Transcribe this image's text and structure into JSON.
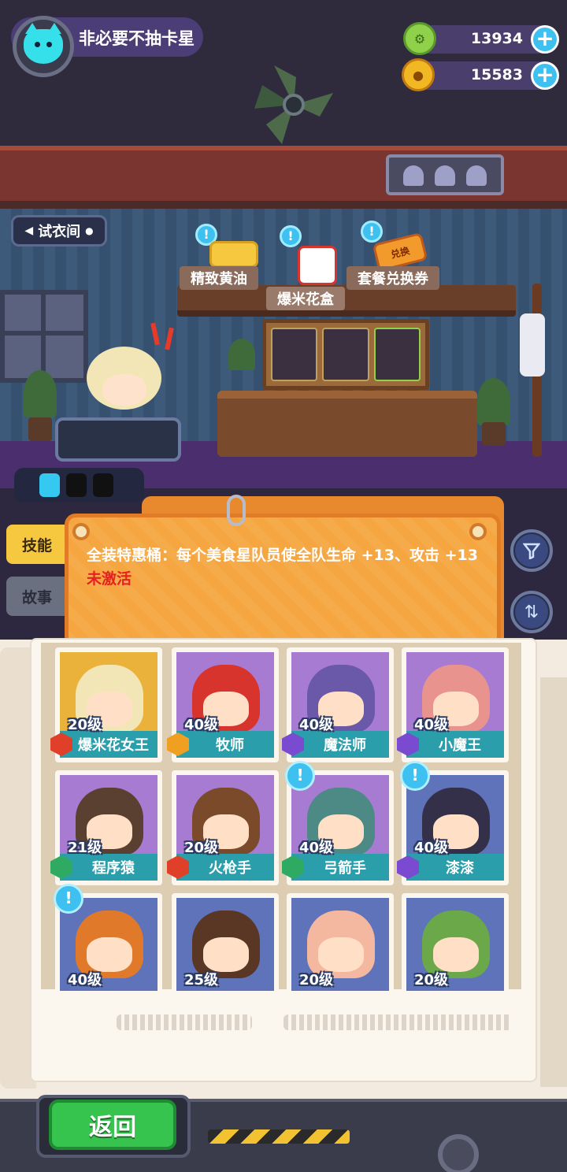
{
  "player": {
    "name": "非必要不抽卡星"
  },
  "currencies": [
    {
      "icon": "green-gear-coin-icon",
      "value": "13934",
      "color": "#8fd14a"
    },
    {
      "icon": "gold-planet-coin-icon",
      "value": "15583",
      "color": "#f2b824"
    }
  ],
  "room": {
    "fitting_room_label": "试衣间",
    "shelf_items": [
      {
        "label": "精致黄油",
        "icon": "butter-icon"
      },
      {
        "label": "爆米花盒",
        "icon": "popcorn-box-icon"
      },
      {
        "label": "套餐兑换券",
        "icon": "meal-coupon-icon",
        "badge": "兑换"
      }
    ],
    "info_glyph": "!"
  },
  "side_tabs": [
    {
      "label": "技能",
      "active": true
    },
    {
      "label": "故事",
      "active": false
    }
  ],
  "skill": {
    "description": "全装特惠桶：每个美食星队员使全队生命 +13、攻击 +13",
    "status": "未激活"
  },
  "tools": {
    "filter_icon": "filter-icon",
    "sort_icon": "sort-swap-icon"
  },
  "roster": [
    {
      "level": "20级",
      "name": "爆米花女王",
      "bg": "gold",
      "rarity_color": "#e0402a",
      "hair": "#f3e6b6",
      "bubble": false
    },
    {
      "level": "40级",
      "name": "牧师",
      "bg": "purple",
      "rarity_color": "#f0a020",
      "hair": "#d8342e",
      "bubble": false
    },
    {
      "level": "40级",
      "name": "魔法师",
      "bg": "purple",
      "rarity_color": "#7a4ad0",
      "hair": "#6a58a8",
      "bubble": false
    },
    {
      "level": "40级",
      "name": "小魔王",
      "bg": "purple",
      "rarity_color": "#7a4ad0",
      "hair": "#e8938e",
      "bubble": false
    },
    {
      "level": "21级",
      "name": "程序猿",
      "bg": "purple",
      "rarity_color": "#2faa62",
      "hair": "#5a4030",
      "bubble": false
    },
    {
      "level": "20级",
      "name": "火枪手",
      "bg": "purple",
      "rarity_color": "#e0402a",
      "hair": "#7a4a2a",
      "bubble": false
    },
    {
      "level": "40级",
      "name": "弓箭手",
      "bg": "purple",
      "rarity_color": "#2faa62",
      "hair": "#4d8a86",
      "bubble": true
    },
    {
      "level": "40级",
      "name": "漆漆",
      "bg": "blue",
      "rarity_color": "#7a4ad0",
      "hair": "#34304a",
      "bubble": true
    },
    {
      "level": "40级",
      "name": "",
      "bg": "blue",
      "rarity_color": "",
      "hair": "#e07a2a",
      "bubble": true
    },
    {
      "level": "25级",
      "name": "",
      "bg": "blue",
      "rarity_color": "",
      "hair": "#5a3624",
      "bubble": false
    },
    {
      "level": "20级",
      "name": "",
      "bg": "blue",
      "rarity_color": "",
      "hair": "#f4b8a0",
      "bubble": false
    },
    {
      "level": "20级",
      "name": "",
      "bg": "blue",
      "rarity_color": "",
      "hair": "#6aa84a",
      "bubble": false
    }
  ],
  "footer": {
    "back_label": "返回"
  }
}
